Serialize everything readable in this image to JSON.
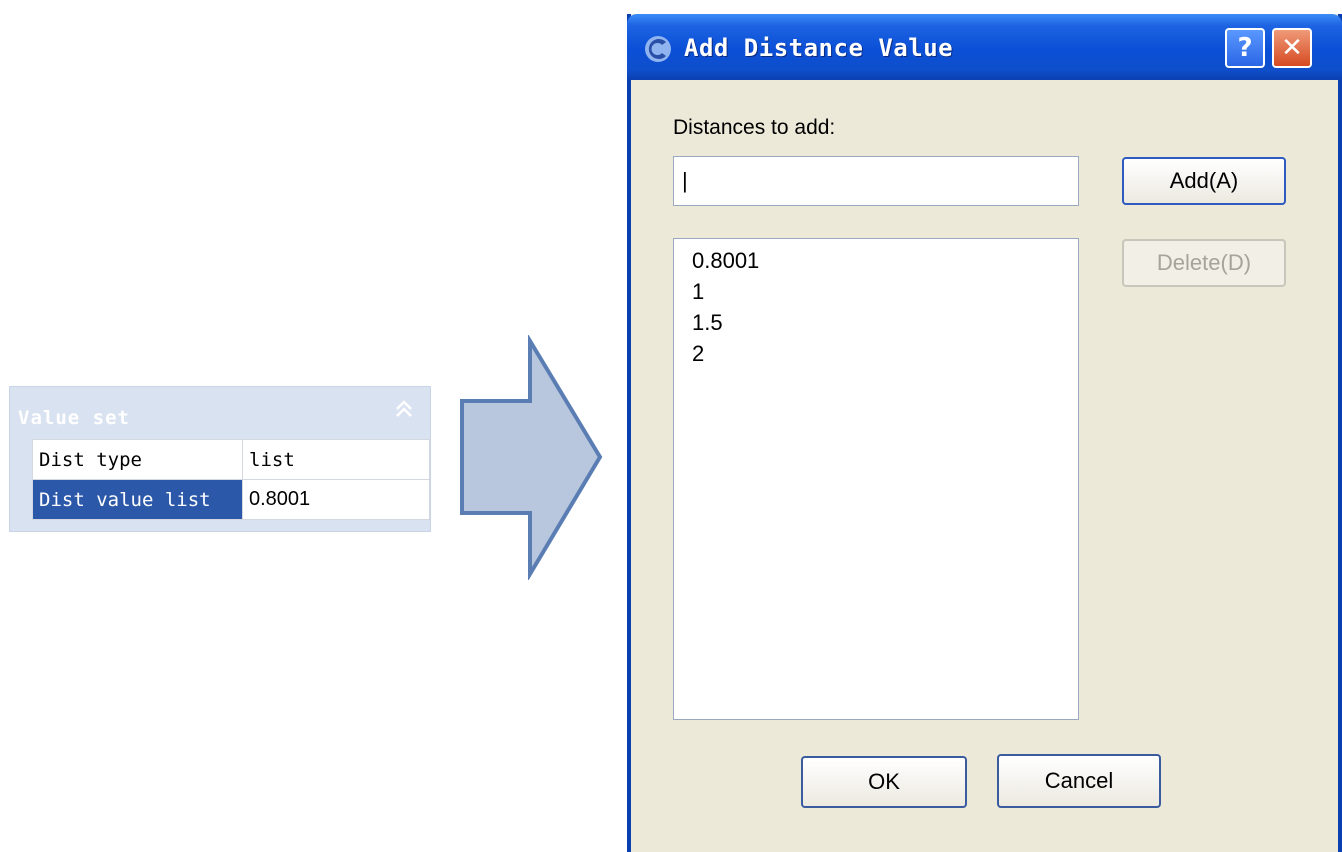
{
  "property_panel": {
    "title": "Value set",
    "rows": [
      {
        "key": "Dist type",
        "value": "list"
      },
      {
        "key": "Dist value list",
        "value": "0.8001"
      }
    ]
  },
  "dialog": {
    "title": "Add Distance Value",
    "help_label": "?",
    "close_label": "✕",
    "distances_label": "Distances to add:",
    "input_value": "|",
    "list_items": [
      "0.8001",
      "1",
      "1.5",
      "2"
    ],
    "buttons": {
      "add": "Add(A)",
      "delete": "Delete(D)",
      "ok": "OK",
      "cancel": "Cancel"
    }
  },
  "colors": {
    "titlebar": "#0a4fd6",
    "dialog_bg": "#ece9d8",
    "panel_bg": "#d9e2f1",
    "selected_cell": "#2b58a8",
    "arrow_fill": "#b8c7dd",
    "arrow_stroke": "#5a7db3"
  },
  "icons": {
    "collapse": "double-chevron-up-icon",
    "arrow": "right-arrow-icon",
    "app": "app-icon"
  }
}
